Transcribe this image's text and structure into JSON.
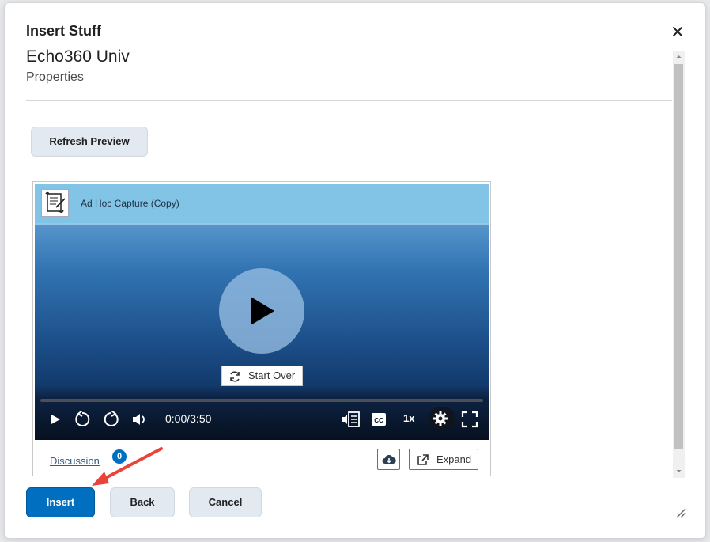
{
  "dialog": {
    "title": "Insert Stuff",
    "close_icon": "close-icon"
  },
  "content": {
    "heading": "Echo360 Univ",
    "subheading": "Properties",
    "refresh_label": "Refresh Preview"
  },
  "player": {
    "title": "Ad Hoc Capture (Copy)",
    "start_over_label": "Start Over",
    "time": "0:00/3:50",
    "speed": "1x",
    "progress_fraction": 0,
    "icons": [
      "play-icon",
      "rewind-icon",
      "forward-icon",
      "volume-icon",
      "transcript-icon",
      "cc-icon",
      "settings-icon",
      "fullscreen-icon"
    ]
  },
  "below_player": {
    "discussion_label": "Discussion",
    "discussion_count": "0",
    "expand_label": "Expand",
    "download_icon": "cloud-download-icon"
  },
  "footer": {
    "insert_label": "Insert",
    "back_label": "Back",
    "cancel_label": "Cancel"
  },
  "colors": {
    "primary": "#006fbf",
    "secondary_button": "#e3e9f1",
    "annotation_arrow": "#e8443a"
  }
}
